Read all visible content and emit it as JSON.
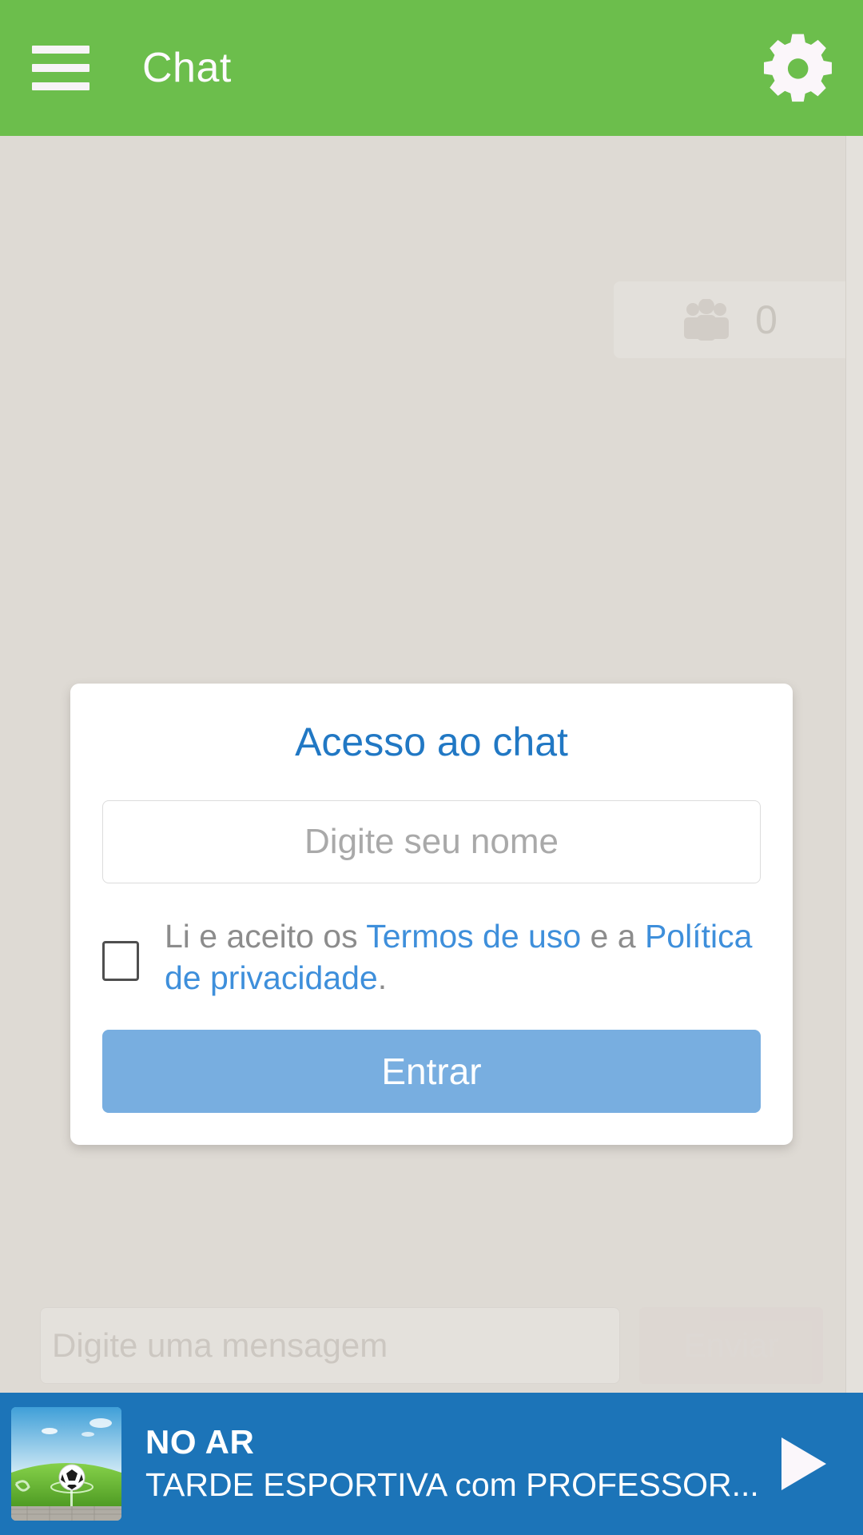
{
  "theme": {
    "header_green": "#6CBE4C",
    "chat_background": "#DEDAD4",
    "card_white": "#FFFFFF",
    "title_blue": "#2178C4",
    "link_blue": "#3E8FDB",
    "button_blue": "#78AEE0",
    "player_blue": "#1C74B8",
    "placeholder_gray": "#A9A9A9"
  },
  "header": {
    "title": "Chat",
    "menu_icon": "hamburger-menu-icon",
    "settings_icon": "gear-icon"
  },
  "chat": {
    "participants": {
      "icon": "users-group-icon",
      "count": "0"
    },
    "composer": {
      "input_placeholder": "Digite uma mensagem",
      "send_label": "Enviar"
    }
  },
  "login_modal": {
    "title": "Acesso ao chat",
    "name_input": {
      "placeholder": "Digite seu nome",
      "value": ""
    },
    "terms": {
      "checked": false,
      "prefix": "Li e aceito os ",
      "terms_link": "Termos de uso",
      "middle": " e a ",
      "privacy_link": "Política de privacidade",
      "suffix": "."
    },
    "submit_label": "Entrar"
  },
  "player": {
    "status_label": "NO AR",
    "program_name": "TARDE ESPORTIVA com PROFESSOR...",
    "play_icon": "play-triangle-icon",
    "thumbnail_icon": "soccer-field-thumbnail"
  }
}
